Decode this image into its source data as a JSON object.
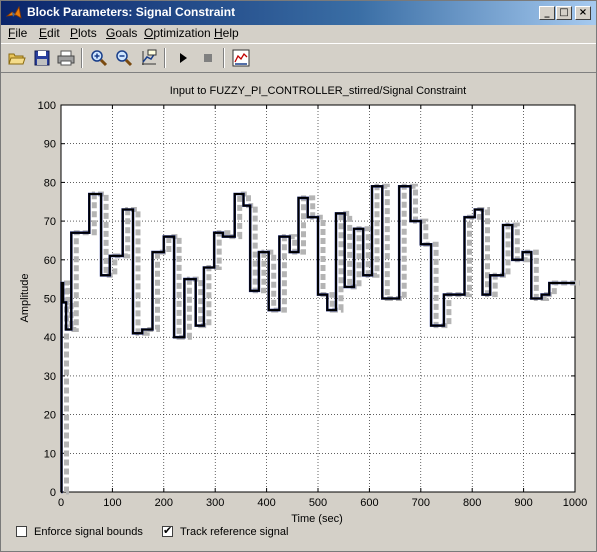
{
  "window": {
    "title": "Block Parameters: Signal Constraint"
  },
  "titlebar_buttons": {
    "minimize": "_",
    "maximize": "□",
    "close": "×"
  },
  "menu": {
    "items": [
      {
        "label": "File",
        "key": "F",
        "rest": "ile"
      },
      {
        "label": "Edit",
        "key": "E",
        "rest": "dit"
      },
      {
        "label": "Plots",
        "key": "P",
        "rest": "lots"
      },
      {
        "label": "Goals",
        "key": "G",
        "rest": "oals"
      },
      {
        "label": "Optimization",
        "key": "O",
        "rest": "ptimization"
      },
      {
        "label": "Help",
        "key": "H",
        "rest": "elp"
      }
    ]
  },
  "toolbar": {
    "tools": [
      "open-icon",
      "save-icon",
      "print-icon",
      "zoom-in-icon",
      "zoom-out-icon",
      "data-cursor-icon",
      "play-icon",
      "stop-icon",
      "response-plot-icon"
    ]
  },
  "chart_data": {
    "type": "line",
    "title": "Input to FUZZY_PI_CONTROLLER_stirred/Signal Constraint",
    "xlabel": "Time (sec)",
    "ylabel": "Amplitude",
    "xlim": [
      0,
      1000
    ],
    "ylim": [
      0,
      100
    ],
    "xticks": [
      0,
      100,
      200,
      300,
      400,
      500,
      600,
      700,
      800,
      900,
      1000
    ],
    "yticks": [
      0,
      10,
      20,
      30,
      40,
      50,
      60,
      70,
      80,
      90,
      100
    ],
    "grid": true,
    "series": [
      {
        "color": "#000000",
        "style": "solid",
        "x": [
          0,
          1,
          1,
          4,
          4,
          10,
          10,
          20,
          20,
          38,
          38,
          55,
          55,
          78,
          78,
          95,
          95,
          120,
          120,
          140,
          140,
          158,
          158,
          178,
          178,
          200,
          200,
          220,
          220,
          240,
          240,
          262,
          262,
          278,
          278,
          298,
          298,
          315,
          315,
          338,
          338,
          355,
          355,
          368,
          368,
          385,
          385,
          404,
          404,
          425,
          425,
          445,
          445,
          462,
          462,
          480,
          480,
          500,
          500,
          518,
          518,
          535,
          535,
          552,
          552,
          570,
          570,
          588,
          588,
          605,
          605,
          625,
          625,
          658,
          658,
          680,
          680,
          700,
          700,
          720,
          720,
          745,
          745,
          785,
          785,
          805,
          805,
          820,
          820,
          835,
          835,
          860,
          860,
          878,
          878,
          898,
          898,
          915,
          915,
          935,
          935,
          950,
          950,
          968,
          968,
          982,
          982,
          1000
        ],
        "y": [
          0,
          0,
          54,
          54,
          49,
          49,
          42,
          42,
          67,
          67,
          67,
          67,
          77,
          77,
          56,
          56,
          61,
          61,
          73,
          73,
          41,
          41,
          42,
          42,
          62,
          62,
          66,
          66,
          40,
          40,
          55,
          55,
          43,
          43,
          58,
          58,
          67,
          67,
          66,
          66,
          77,
          77,
          74,
          74,
          52,
          52,
          62,
          62,
          47,
          47,
          66,
          66,
          62,
          62,
          76,
          76,
          71,
          71,
          51,
          51,
          47,
          47,
          72,
          72,
          53,
          53,
          68,
          68,
          56,
          56,
          79,
          79,
          50,
          50,
          79,
          79,
          70,
          70,
          64,
          64,
          43,
          43,
          51,
          51,
          71,
          71,
          73,
          73,
          51,
          51,
          56,
          56,
          69,
          69,
          60,
          60,
          62,
          62,
          50,
          50,
          51,
          51,
          54,
          54,
          54,
          54,
          54,
          54
        ]
      }
    ]
  },
  "options": {
    "enforce_bounds": {
      "label": "Enforce signal bounds",
      "checked": false
    },
    "track_reference": {
      "label": "Track reference signal",
      "checked": true,
      "mark": "✔"
    }
  }
}
